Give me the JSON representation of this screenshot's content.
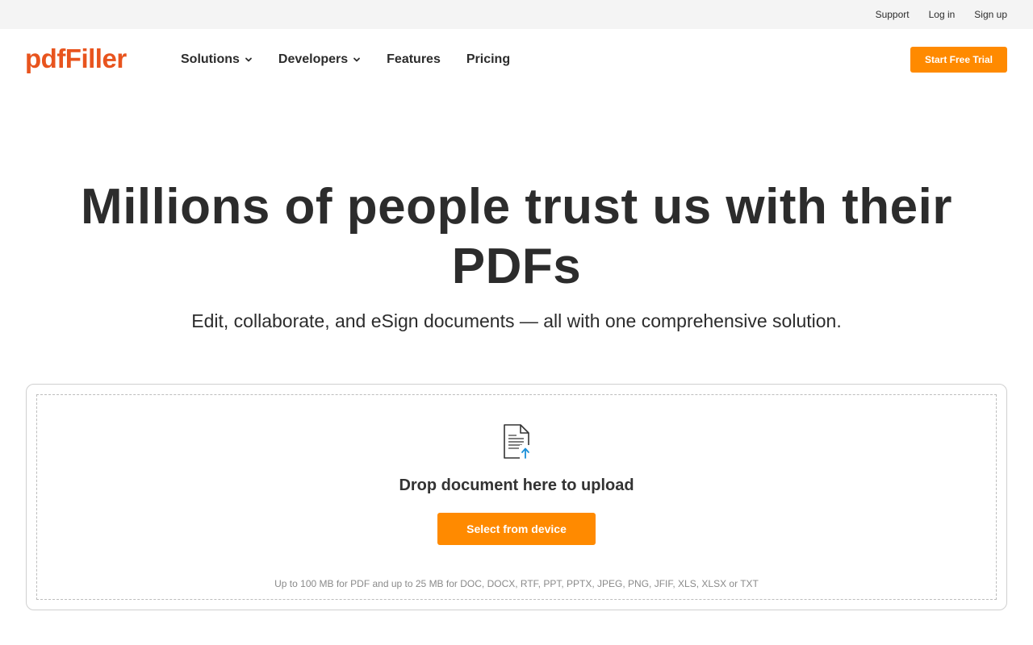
{
  "topbar": {
    "links": [
      "Support",
      "Log in",
      "Sign up"
    ]
  },
  "header": {
    "logo": "pdfFiller",
    "nav": [
      {
        "label": "Solutions",
        "icon": "chevron-down-icon"
      },
      {
        "label": "Developers",
        "icon": "chevron-down-icon"
      },
      {
        "label": "Features"
      },
      {
        "label": "Pricing"
      }
    ],
    "cta_label": "Start Free Trial"
  },
  "hero": {
    "title": "Millions of people trust us with their PDFs",
    "subtitle": "Edit, collaborate, and eSign documents — all with one comprehensive solution."
  },
  "upload": {
    "icon": "document-upload-icon",
    "drop_text": "Drop document here to upload",
    "button_label": "Select from device",
    "limits": "Up to 100 MB for PDF and up to 25 MB for DOC, DOCX, RTF, PPT, PPTX, JPEG, PNG, JFIF, XLS, XLSX or TXT"
  },
  "colors": {
    "brand": "#e8541e",
    "accent": "#ff8a00",
    "upload_arrow": "#1a8fd8"
  }
}
